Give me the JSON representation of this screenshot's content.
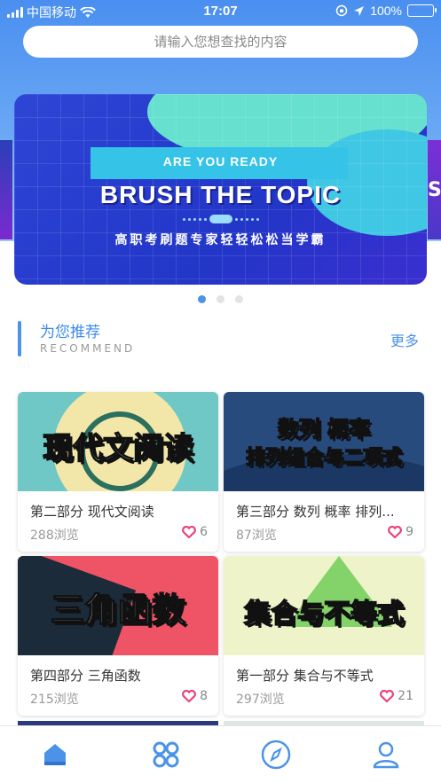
{
  "status_bar": {
    "carrier": "中国移动",
    "time": "17:07",
    "battery": "100%"
  },
  "search": {
    "placeholder": "请输入您想查找的内容"
  },
  "banner": {
    "tag": "ARE YOU READY",
    "title": "BRUSH THE TOPIC",
    "subtitle": "高职考刷题专家轻轻松松当学霸",
    "peek_right": "S",
    "pages": 3,
    "active_page": 1
  },
  "section": {
    "title": "为您推荐",
    "subtitle": "RECOMMEND",
    "more": "更多"
  },
  "cards": [
    {
      "thumb_text": "现代文阅读",
      "name": "第二部分 现代文阅读",
      "views": "288浏览",
      "likes": "6"
    },
    {
      "thumb_text": "数列 概率 排列组合与二项式",
      "thumb_line1": "数列 概率",
      "thumb_line2": "排列组合与二项式",
      "name": "第三部分 数列 概率 排列...",
      "views": "87浏览",
      "likes": "9"
    },
    {
      "thumb_text": "三角函数",
      "name": "第四部分 三角函数",
      "views": "215浏览",
      "likes": "8"
    },
    {
      "thumb_text": "集合与不等式",
      "name": "第一部分 集合与不等式",
      "views": "297浏览",
      "likes": "21"
    }
  ],
  "tabbar": {
    "items": [
      {
        "icon": "home-icon",
        "active": true
      },
      {
        "icon": "grid-icon",
        "active": false
      },
      {
        "icon": "compass-icon",
        "active": false
      },
      {
        "icon": "user-icon",
        "active": false
      }
    ]
  },
  "colors": {
    "accent": "#4a93e8",
    "heart": "#e8457a",
    "battery": "#4cd964"
  }
}
